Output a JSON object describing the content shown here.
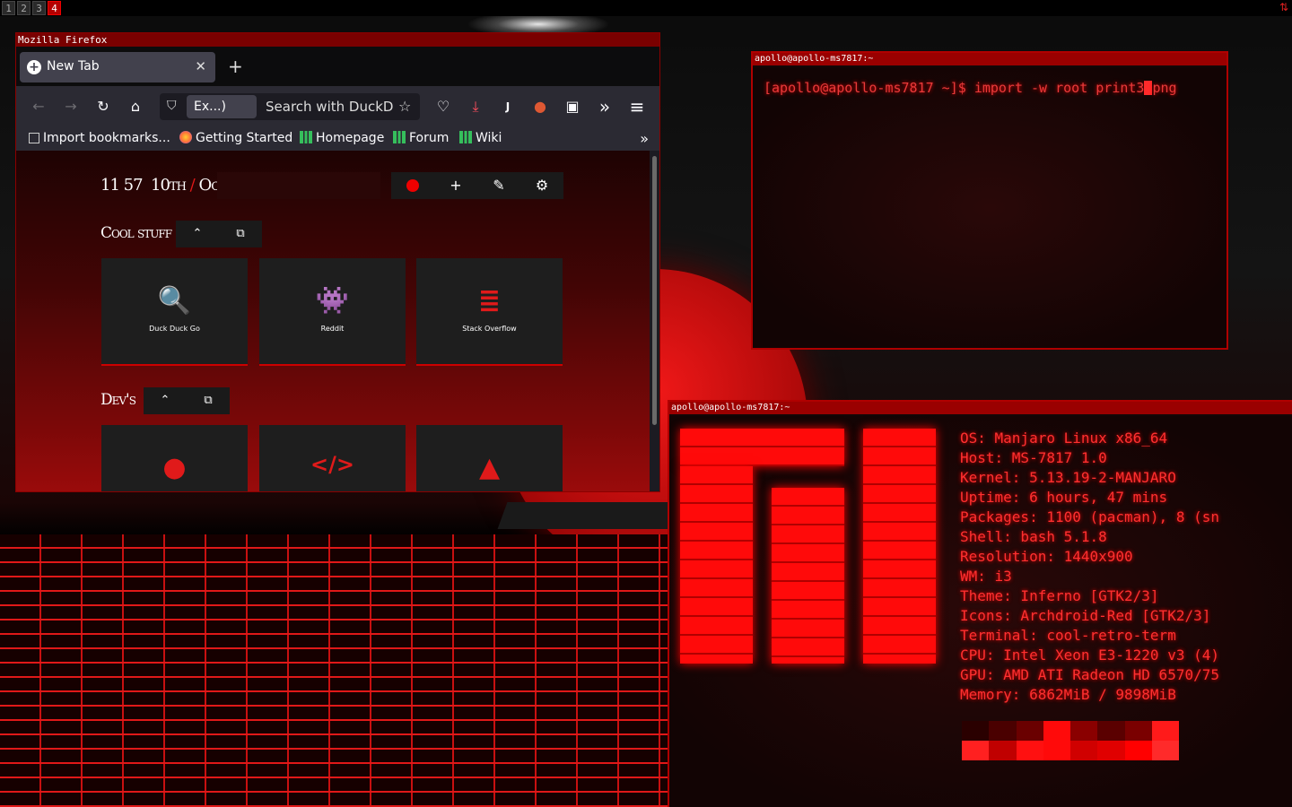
{
  "workspaces": [
    {
      "label": "1",
      "active": false
    },
    {
      "label": "2",
      "active": false
    },
    {
      "label": "3",
      "active": false
    },
    {
      "label": "4",
      "active": true
    }
  ],
  "tray": {
    "icon": "network-arrows-icon",
    "glyph": "⇅"
  },
  "firefox": {
    "window_title": "Mozilla Firefox",
    "tab": {
      "label": "New Tab",
      "close": "✕"
    },
    "new_tab": "+",
    "nav": {
      "back": "←",
      "forward": "→",
      "reload": "↻",
      "home": "⌂"
    },
    "urlbar": {
      "shield": "⛉",
      "extension_chip": "Ex...)",
      "placeholder": "Search with DuckDu",
      "star": "☆"
    },
    "toolbar_icons": [
      {
        "name": "pocket-icon",
        "glyph": "♡"
      },
      {
        "name": "download-icon",
        "glyph": "⤓"
      },
      {
        "name": "account-icon",
        "glyph": "J"
      },
      {
        "name": "duckduckgo-extension-icon",
        "glyph": "●"
      },
      {
        "name": "extension-icon",
        "glyph": "▣"
      },
      {
        "name": "overflow-icon",
        "glyph": "»"
      },
      {
        "name": "menu-icon",
        "glyph": "≡"
      }
    ],
    "bookmarks": [
      {
        "label": "Import bookmarks...",
        "icon": "import-icon"
      },
      {
        "label": "Getting Started",
        "icon": "firefox-icon"
      },
      {
        "label": "Homepage",
        "icon": "manjaro-icon"
      },
      {
        "label": "Forum",
        "icon": "manjaro-icon"
      },
      {
        "label": "Wiki",
        "icon": "manjaro-icon"
      }
    ],
    "bookmarks_more": "»",
    "newtab": {
      "clock": {
        "hour": "11",
        "minute": "57",
        "day": "10th",
        "slash": "/",
        "month": "Oct"
      },
      "search_value": "",
      "tools": {
        "add": "+",
        "edit": "✎",
        "settings": "⚙"
      },
      "groups": [
        {
          "title": "Cool stuff",
          "collapse": "⌃",
          "open_all": "⧉",
          "tiles": [
            {
              "label": "Duck Duck Go",
              "icon": "search-icon",
              "glyph": "🔍"
            },
            {
              "label": "Reddit",
              "icon": "reddit-icon",
              "glyph": "👾"
            },
            {
              "label": "Stack Overflow",
              "icon": "stackoverflow-icon",
              "glyph": "≣"
            }
          ]
        },
        {
          "title": "Dev's",
          "collapse": "⌃",
          "open_all": "⧉",
          "tiles": [
            {
              "label": "",
              "icon": "github-icon",
              "glyph": "●"
            },
            {
              "label": "",
              "icon": "code-icon",
              "glyph": "</>"
            },
            {
              "label": "",
              "icon": "android-icon",
              "glyph": "▲"
            }
          ]
        }
      ]
    }
  },
  "terminal_top": {
    "title": "apollo@apollo-ms7817:~",
    "prompt": "[apollo@apollo-ms7817 ~]$ ",
    "command_before_cursor": "import -w root print3",
    "command_after_cursor": "png"
  },
  "terminal_neofetch": {
    "title": "apollo@apollo-ms7817:~",
    "info": [
      "OS: Manjaro Linux x86_64",
      "Host: MS-7817 1.0",
      "Kernel: 5.13.19-2-MANJARO",
      "Uptime: 6 hours, 47 mins",
      "Packages: 1100 (pacman), 8 (sn",
      "Shell: bash 5.1.8",
      "Resolution: 1440x900",
      "WM: i3",
      "Theme: Inferno [GTK2/3]",
      "Icons: Archdroid-Red [GTK2/3]",
      "Terminal: cool-retro-term",
      "CPU: Intel Xeon E3-1220 v3 (4)",
      "GPU: AMD ATI Radeon HD 6570/75",
      "Memory: 6862MiB / 9898MiB"
    ],
    "color_swatches": [
      "#2a0000",
      "#4a0000",
      "#6a0000",
      "#ff0a0a",
      "#8a0000",
      "#5a0000",
      "#7a0000",
      "#ff1a1a",
      "#ff2020",
      "#c00000",
      "#ff1010",
      "#ff0a0a",
      "#d00000",
      "#e00000",
      "#ff0000",
      "#ff2a2a"
    ]
  },
  "colors": {
    "accent": "#e01818",
    "i3_title": "#7a0000",
    "ff_tab": "#42414d"
  }
}
